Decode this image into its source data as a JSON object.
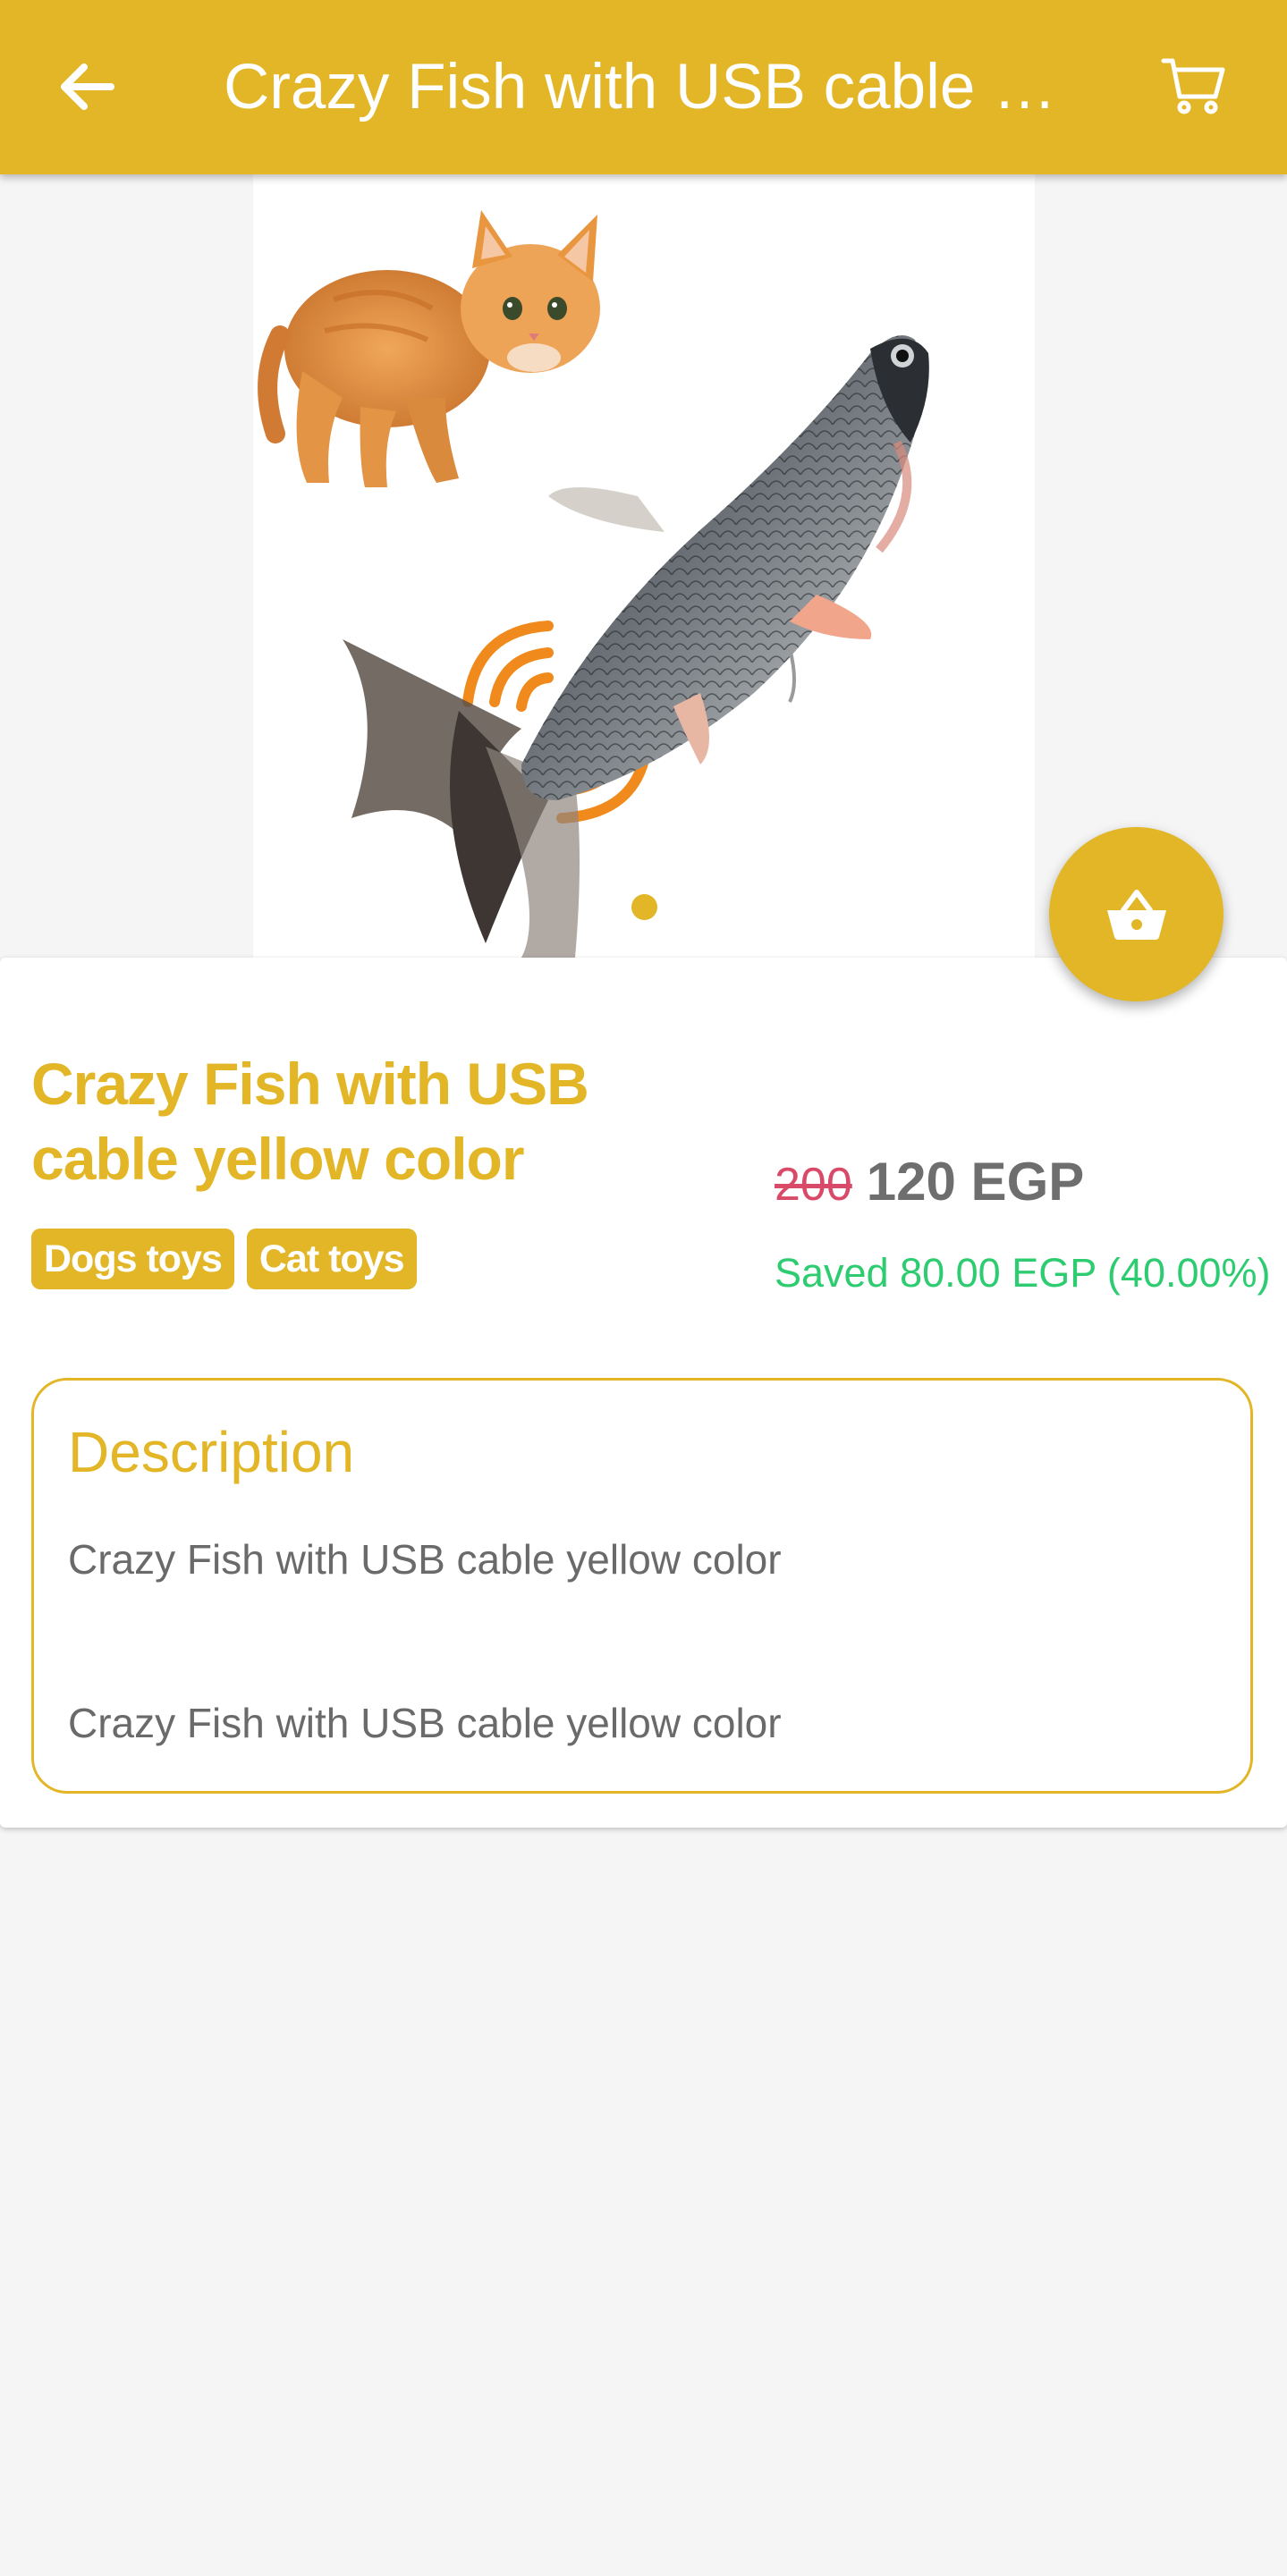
{
  "app_bar": {
    "title": "Crazy Fish with USB cable yel…",
    "back_icon": "arrow-left-icon",
    "cart_icon": "cart-icon",
    "color": "#e2b626"
  },
  "gallery": {
    "image_alt": "Crazy Fish with USB cable yellow color",
    "page_count": 1,
    "current_page": 1
  },
  "fab": {
    "icon": "basket-icon"
  },
  "product": {
    "name": "Crazy Fish with USB cable yellow color",
    "tags": [
      "Dogs toys",
      "Cat toys"
    ],
    "old_price": "200",
    "new_price": "120 EGP",
    "saved": "Saved 80.00 EGP (40.00%)"
  },
  "description": {
    "title": "Description",
    "lines": [
      "Crazy Fish with USB cable yellow color",
      "Crazy Fish with USB cable yellow color"
    ]
  },
  "colors": {
    "accent": "#e2b626",
    "strike_price": "#d84a67",
    "saved": "#2ecc71",
    "text_muted": "#6e6e6e"
  }
}
